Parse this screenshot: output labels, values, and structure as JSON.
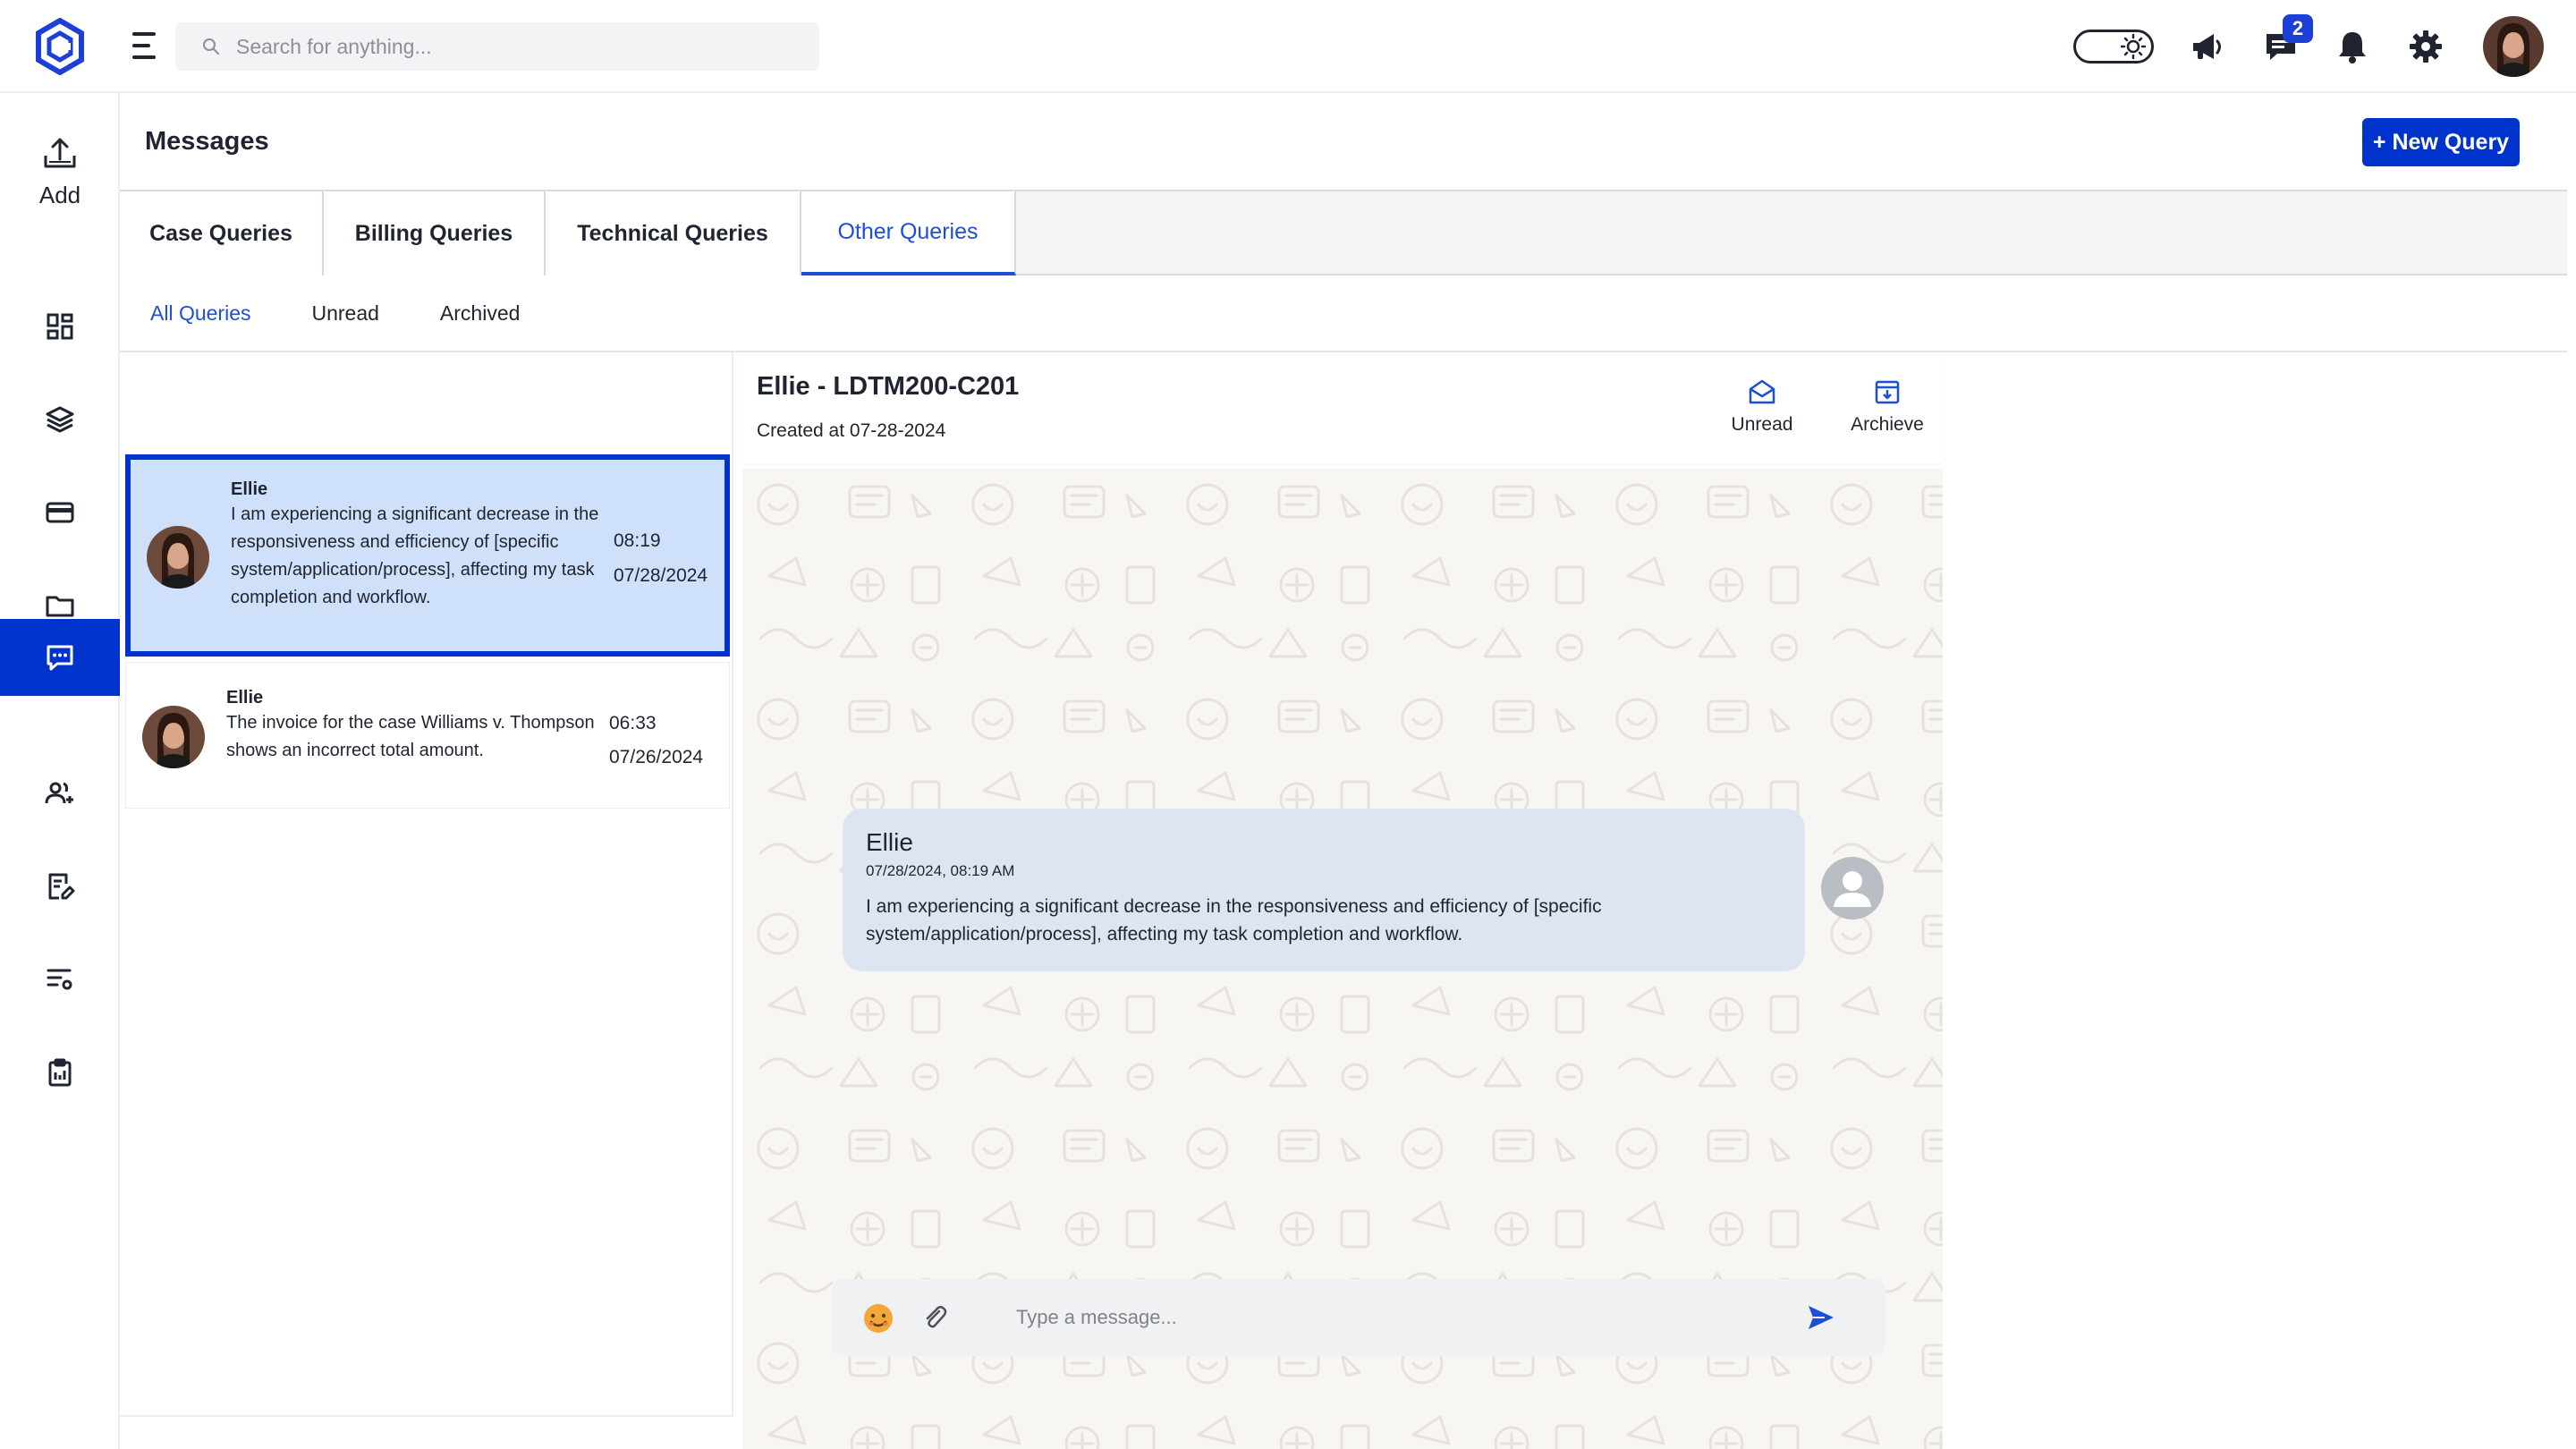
{
  "header": {
    "search_placeholder": "Search for anything...",
    "messages_badge": "2",
    "icons": [
      "menu-icon",
      "search-icon",
      "theme-toggle",
      "megaphone-icon",
      "chat-icon",
      "bell-icon",
      "gear-icon",
      "avatar"
    ]
  },
  "top_progress": {
    "fraction": 0.11
  },
  "sidebar": {
    "add_label": "Add",
    "items": [
      "dashboard-icon",
      "layers-icon",
      "card-icon",
      "folder-icon",
      "messages-icon",
      "users-icon",
      "document-edit-icon",
      "list-settings-icon",
      "clipboard-icon"
    ],
    "active": "messages-icon"
  },
  "page": {
    "title": "Messages",
    "new_query_label": "+ New Query"
  },
  "tabs": [
    {
      "label": "Case Queries",
      "active": false
    },
    {
      "label": "Billing Queries",
      "active": false
    },
    {
      "label": "Technical Queries",
      "active": false
    },
    {
      "label": "Other Queries",
      "active": true
    }
  ],
  "subtabs": [
    {
      "label": "All Queries",
      "active": true
    },
    {
      "label": "Unread",
      "active": false
    },
    {
      "label": "Archived",
      "active": false
    }
  ],
  "queries": [
    {
      "name": "Ellie",
      "message": "I am experiencing a significant decrease in the responsiveness and efficiency of [specific system/application/process], affecting my task completion and workflow.",
      "time": "08:19",
      "date": "07/28/2024",
      "selected": true
    },
    {
      "name": "Ellie",
      "message": "The invoice for the case Williams v. Thompson shows an incorrect total amount.",
      "time": "06:33",
      "date": "07/26/2024",
      "selected": false
    }
  ],
  "conversation": {
    "title": "Ellie - LDTM200-C201",
    "created": "Created at 07-28-2024",
    "unread_label": "Unread",
    "archive_label": "Archieve",
    "message": {
      "sender": "Ellie",
      "timestamp": "07/28/2024, 08:19 AM",
      "text": "I am experiencing a significant decrease in the responsiveness and efficiency of [specific system/application/process], affecting my task completion and workflow."
    },
    "composer_placeholder": "Type a message..."
  },
  "colors": {
    "primary": "#0033cc",
    "active_tab": "#1d4ed8",
    "selected_item_bg": "#cfe0fa",
    "bubble_bg": "#dde5f2"
  }
}
